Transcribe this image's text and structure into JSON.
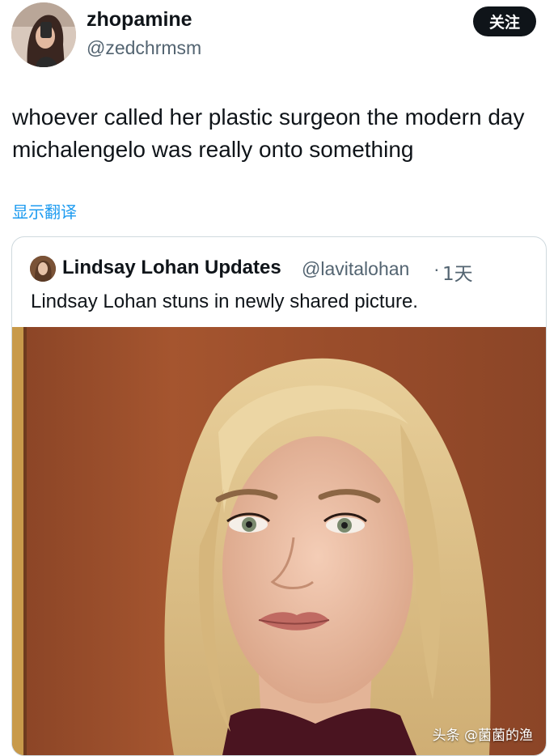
{
  "author": {
    "display_name": "zhopamine",
    "handle": "@zedchrmsm"
  },
  "follow_button_label": "关注",
  "tweet": {
    "text": "whoever called her plastic surgeon the modern day michalengelo was really onto something",
    "translate_label": "显示翻译"
  },
  "quoted_tweet": {
    "display_name": "Lindsay Lohan Updates",
    "handle": "@lavitalohan",
    "separator": "·",
    "time": "1天",
    "text": "Lindsay Lohan stuns in newly shared picture."
  },
  "watermark": "头条 @菌菌的渔",
  "colors": {
    "text_primary": "#0f1419",
    "text_secondary": "#536471",
    "link": "#1d9bf0",
    "button_bg": "#0f1419",
    "card_border": "#cfd9de"
  }
}
